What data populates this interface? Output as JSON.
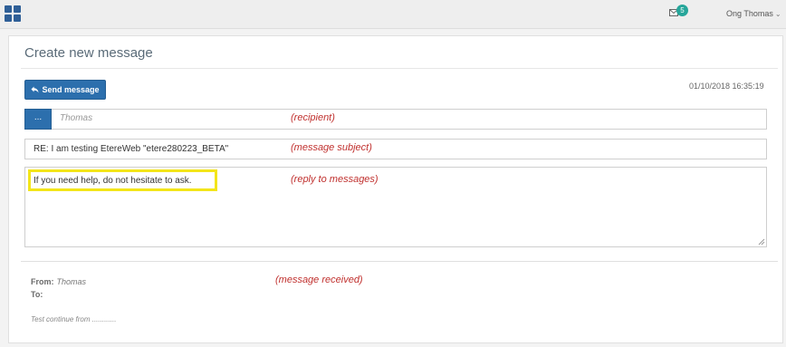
{
  "topbar": {
    "apps_icon": "grid-icon",
    "mail_icon": "envelope-icon",
    "unread_count": "5",
    "user_name": "Ong Thomas",
    "user_menu_icon": "chevron-down-icon"
  },
  "panel": {
    "title": "Create new message",
    "send_button_label": "Send message",
    "send_icon": "reply-icon",
    "timestamp": "01/10/2018 16:35:19"
  },
  "form": {
    "recipient_button_label": "...",
    "recipient_value": "Thomas",
    "subject_value": "RE: I am testing EtereWeb \"etere280223_BETA\"",
    "body_value": "If you need help, do not hesitate to ask."
  },
  "annotations": {
    "recipient_note": "(recipient)",
    "subject_note": "(message subject)",
    "reply_note": "(reply to messages)",
    "received_note": "(message received)"
  },
  "received": {
    "from_label": "From:",
    "from_value": "Thomas",
    "to_label": "To:",
    "to_value": "",
    "body_preview": "Test continue from ............"
  },
  "colors": {
    "accent": "#2c6fad",
    "badge": "#26a69a",
    "annotation": "#c0302e",
    "highlight": "#f3e51a"
  }
}
